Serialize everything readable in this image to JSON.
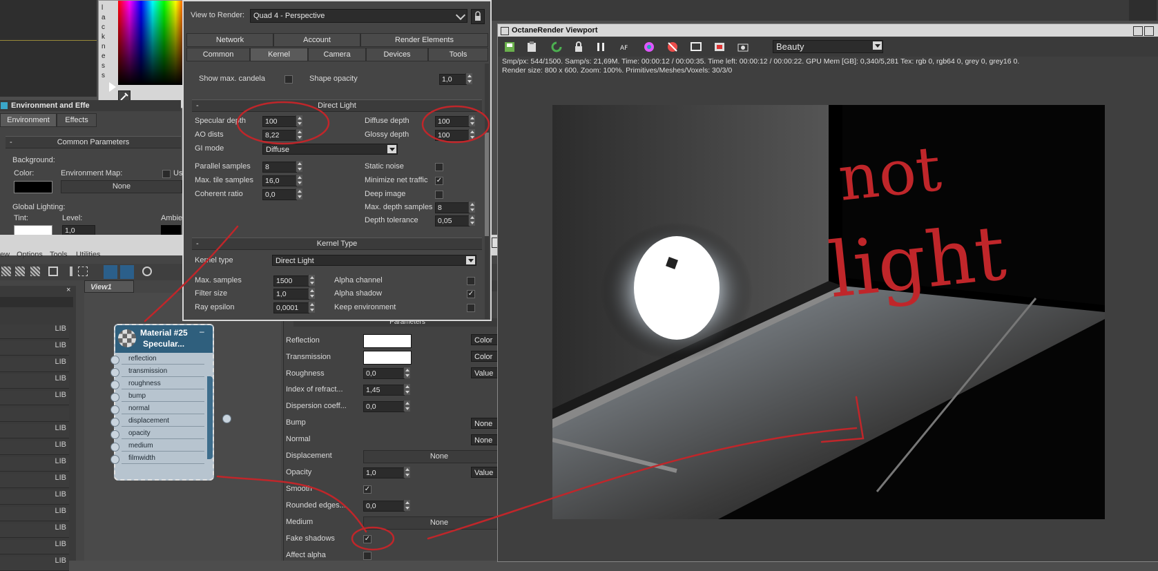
{
  "env_panel": {
    "title": "Environment and Effe",
    "tabs": [
      "Environment",
      "Effects"
    ],
    "common_parameters": "Common Parameters",
    "background_label": "Background:",
    "color_label": "Color:",
    "environment_map_label": "Environment Map:",
    "use_map_label": "Us",
    "map_button": "None",
    "global_lighting_label": "Global Lighting:",
    "tint_label": "Tint:",
    "level_label": "Level:",
    "level_value": "1,0",
    "ambient_label": "Ambie",
    "blackness_letters": [
      "l",
      "a",
      "c",
      "k",
      "n",
      "e",
      "s",
      "s"
    ]
  },
  "render_setup": {
    "view_to_render_label": "View to Render:",
    "view_to_render_value": "Quad 4 - Perspective",
    "tabs_top": [
      "Network",
      "Account",
      "Render Elements"
    ],
    "tabs_bottom": [
      "Common",
      "Kernel",
      "Camera",
      "Devices",
      "Tools"
    ],
    "show_max_candela": "Show max. candela",
    "shape_opacity": "Shape opacity",
    "shape_opacity_value": "1,0",
    "direct_light": {
      "title": "Direct Light",
      "specular_depth": "Specular depth",
      "specular_depth_value": "100",
      "diffuse_depth": "Diffuse depth",
      "diffuse_depth_value": "100",
      "ao_dists": "AO dists",
      "ao_dists_value": "8,22",
      "glossy_depth": "Glossy depth",
      "glossy_depth_value": "100",
      "gi_mode": "GI mode",
      "gi_mode_value": "Diffuse",
      "parallel_samples": "Parallel samples",
      "parallel_samples_value": "8",
      "static_noise": "Static noise",
      "max_tile_samples": "Max. tile samples",
      "max_tile_samples_value": "16,0",
      "minimize_net_traffic": "Minimize net traffic",
      "coherent_ratio": "Coherent ratio",
      "coherent_ratio_value": "0,0",
      "deep_image": "Deep image",
      "max_depth_samples": "Max. depth samples",
      "max_depth_samples_value": "8",
      "depth_tolerance": "Depth tolerance",
      "depth_tolerance_value": "0,05"
    },
    "kernel_type": {
      "title": "Kernel Type",
      "kernel_type_label": "Kernel type",
      "kernel_type_value": "Direct Light",
      "max_samples": "Max. samples",
      "max_samples_value": "1500",
      "alpha_channel": "Alpha channel",
      "filter_size": "Filter size",
      "filter_size_value": "1,0",
      "alpha_shadow": "Alpha shadow",
      "ray_epsilon": "Ray epsilon",
      "ray_epsilon_value": "0,0001",
      "keep_environment": "Keep environment"
    }
  },
  "material_editor": {
    "menu": [
      "ew",
      "Options",
      "Tools",
      "Utilities"
    ],
    "view_tab": "View1",
    "lib_label": "LIB",
    "node_title_1": "Material #25",
    "node_title_2": "Specular...",
    "sockets": [
      "reflection",
      "transmission",
      "roughness",
      "bump",
      "normal",
      "displacement",
      "opacity",
      "medium",
      "filmwidth"
    ],
    "parameters_title": "Parameters",
    "params": {
      "reflection": "Reflection",
      "reflection_mode": "Color",
      "transmission": "Transmission",
      "transmission_mode": "Color",
      "roughness": "Roughness",
      "roughness_value": "0,0",
      "roughness_mode": "Value",
      "ior": "Index of refract...",
      "ior_value": "1,45",
      "dispersion": "Dispersion coeff...",
      "dispersion_value": "0,0",
      "bump": "Bump",
      "bump_mode": "None",
      "normal": "Normal",
      "normal_mode": "None",
      "displacement": "Displacement",
      "displacement_button": "None",
      "opacity": "Opacity",
      "opacity_value": "1,0",
      "opacity_mode": "Value",
      "smooth": "Smooth",
      "rounded_edges": "Rounded edges...",
      "rounded_edges_value": "0,0",
      "medium": "Medium",
      "medium_button": "None",
      "fake_shadows": "Fake shadows",
      "affect_alpha": "Affect alpha"
    }
  },
  "viewport": {
    "title": "OctaneRender Viewport",
    "pass_value": "Beauty",
    "stats_line1": "Smp/px: 544/1500.   Samp/s: 21,69M.   Time: 00:00:12 / 00:00:35.   Time left: 00:00:12 / 00:00:22.   GPU Mem [GB]: 0,340/5,281   Tex: rgb 0, rgb64 0, grey 0, grey16 0.",
    "stats_line2": "Render size: 800 x 600.   Zoom: 100%.   Primitives/Meshes/Voxels: 30/3/0",
    "annotation_1": "not",
    "annotation_2": "light"
  },
  "colors": {
    "annotation": "#c0262a",
    "ui_dark": "#444444",
    "node_header": "#2f5f7d"
  }
}
